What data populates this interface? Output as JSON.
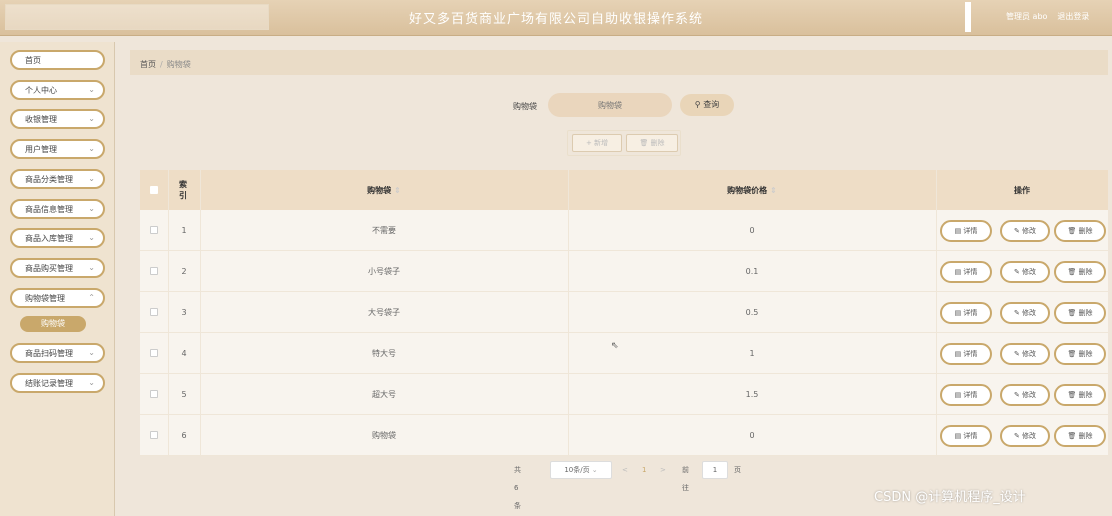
{
  "header": {
    "title": "好又多百货商业广场有限公司自助收银操作系统",
    "user_text": "管理员 abo",
    "logout": "退出登录"
  },
  "sidebar": {
    "items": [
      {
        "label": "首页"
      },
      {
        "label": "个人中心"
      },
      {
        "label": "收银管理"
      },
      {
        "label": "用户管理"
      },
      {
        "label": "商品分类管理"
      },
      {
        "label": "商品信息管理"
      },
      {
        "label": "商品入库管理"
      },
      {
        "label": "商品购买管理"
      },
      {
        "label": "购物袋管理"
      },
      {
        "label": "商品扫码管理"
      },
      {
        "label": "结账记录管理"
      }
    ],
    "sub_item": "购物袋"
  },
  "breadcrumb": {
    "home": "首页",
    "current": "购物袋"
  },
  "search": {
    "label": "购物袋",
    "placeholder": "购物袋",
    "button": "查询"
  },
  "actions": {
    "add": "+ 新增",
    "delete": "删除"
  },
  "table": {
    "headers": {
      "index": "索引",
      "bag": "购物袋",
      "price": "购物袋价格",
      "ops": "操作"
    },
    "rows": [
      {
        "index": "1",
        "bag": "不需要",
        "price": "0"
      },
      {
        "index": "2",
        "bag": "小号袋子",
        "price": "0.1"
      },
      {
        "index": "3",
        "bag": "大号袋子",
        "price": "0.5"
      },
      {
        "index": "4",
        "bag": "特大号",
        "price": "1"
      },
      {
        "index": "5",
        "bag": "超大号",
        "price": "1.5"
      },
      {
        "index": "6",
        "bag": "购物袋",
        "price": "0"
      }
    ],
    "op_labels": {
      "detail": "详情",
      "edit": "修改",
      "delete": "删除"
    }
  },
  "pagination": {
    "total": "共 6 条",
    "page_size": "10条/页",
    "prev": "<",
    "page": "1",
    "next": ">",
    "goto_label": "前往",
    "goto_value": "1",
    "goto_suffix": "页"
  },
  "watermark": "CSDN @计算机程序_设计"
}
